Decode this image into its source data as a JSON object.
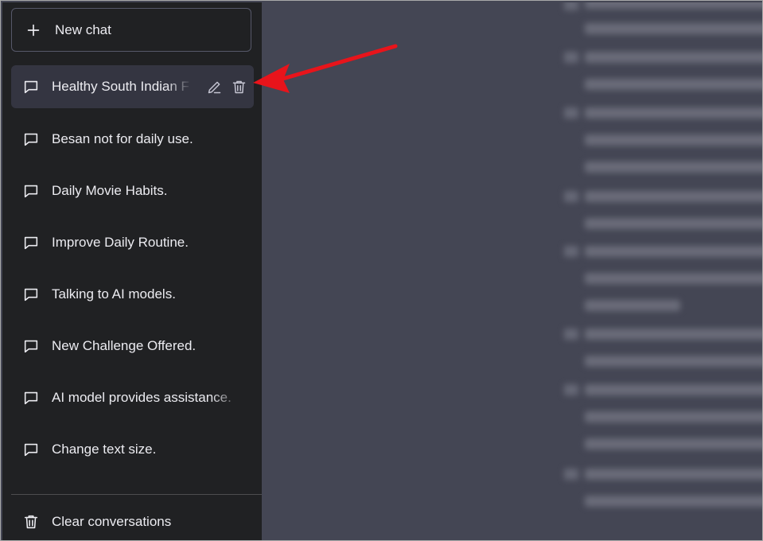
{
  "sidebar": {
    "new_chat_label": "New chat",
    "conversations": [
      {
        "label": "Healthy South Indian F",
        "active": true
      },
      {
        "label": "Besan not for daily use."
      },
      {
        "label": "Daily Movie Habits."
      },
      {
        "label": "Improve Daily Routine."
      },
      {
        "label": "Talking to AI models."
      },
      {
        "label": "New Challenge Offered."
      },
      {
        "label": "AI model provides assistance."
      },
      {
        "label": "Change text size."
      }
    ],
    "clear_label": "Clear conversations"
  },
  "annotation": {
    "arrow_color": "#e8141b"
  },
  "colors": {
    "sidebar_bg": "#202123",
    "main_bg": "#444654",
    "active_item_bg": "#343541",
    "text": "#ececf1"
  }
}
